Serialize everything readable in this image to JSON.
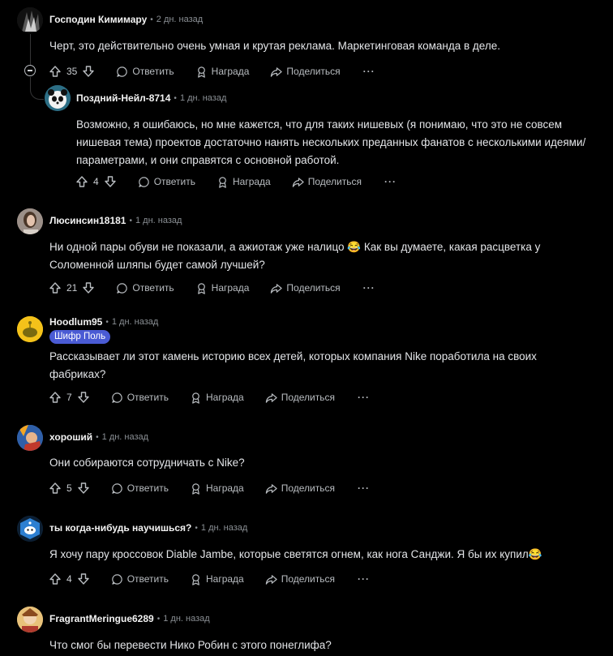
{
  "labels": {
    "reply": "Ответить",
    "award": "Награда",
    "share": "Поделиться",
    "more": "···"
  },
  "comments": [
    {
      "author": "Господин Кимимару",
      "time": "2 дн. назад",
      "text": "Черт, это действительно очень умная и крутая реклама. Маркетинговая команда в деле.",
      "votes": "35",
      "avatar": "dark-character-avatar"
    },
    {
      "author": "Поздний-Нейл-8714",
      "time": "1 дн. назад",
      "text_lines": [
        "Возможно, я ошибаюсь, но мне кажется, что для таких нишевых (я понимаю, что это не совсем",
        "нишевая тема) проектов достаточно нанять нескольких преданных фанатов с несколькими идеями/",
        "параметрами, и они справятся с основной работой."
      ],
      "votes": "4",
      "avatar": "panda-avatar"
    },
    {
      "author": "Люсинсин18181",
      "time": "1 дн. назад",
      "text_lines": [
        "Ни одной пары обуви не показали, а ажиотаж уже налицо 😂  Как вы думаете, какая расцветка у",
        "Соломенной шляпы будет самой лучшей?"
      ],
      "votes": "21",
      "avatar": "portrait-avatar"
    },
    {
      "author": "Hoodlum95",
      "time": "1 дн. назад",
      "flair": "Шифр Поль",
      "text_lines": [
        "Рассказывает ли этот камень историю всех детей, которых компания Nike поработила на своих",
        "фабриках?"
      ],
      "votes": "7",
      "avatar": "yellow-snoo-avatar"
    },
    {
      "author": "хороший",
      "time": "1 дн. назад",
      "text": "Они собираются сотрудничать с Nike?",
      "votes": "5",
      "avatar": "colorful-avatar"
    },
    {
      "author": "ты когда-нибудь научишься?",
      "time": "1 дн. назад",
      "text": "Я хочу пару кроссовок Diable Jambe, которые светятся огнем, как нога Санджи. Я бы их купил😂",
      "votes": "4",
      "avatar": "blue-snoo-avatar"
    },
    {
      "author": "FragrantMeringue6289",
      "time": "1 дн. назад",
      "text": "Что смог бы перевести Нико Робин с этого понеглифа?",
      "avatar": "anime-character-avatar"
    }
  ],
  "colors": {
    "background": "#000000",
    "flair": "#4a5bd4",
    "text": "#e3e5e8",
    "muted": "#8a8f94"
  }
}
